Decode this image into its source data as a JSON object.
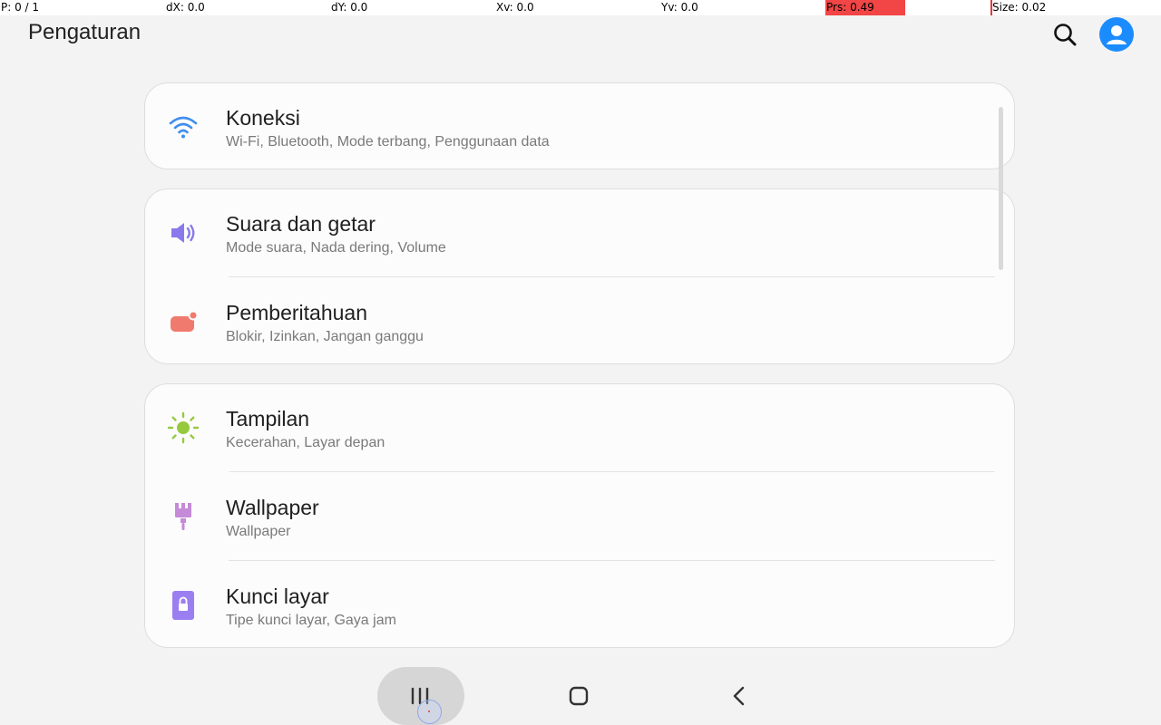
{
  "debug": {
    "pointer": "P: 0 / 1",
    "dx": "dX: 0.0",
    "dy": "dY: 0.0",
    "xv": "Xv: 0.0",
    "yv": "Yv: 0.0",
    "prs": "Prs: 0.49",
    "size": "Size: 0.02"
  },
  "header": {
    "title": "Pengaturan",
    "search_icon": "search-icon",
    "avatar_icon": "account-icon",
    "avatar_color": "#1a8cff"
  },
  "settings": {
    "connections": {
      "label": "Koneksi",
      "sub": "Wi-Fi, Bluetooth, Mode terbang, Penggunaan data",
      "icon": "wifi-icon",
      "color": "#3f8ef0"
    },
    "sound": {
      "label": "Suara dan getar",
      "sub": "Mode suara, Nada dering, Volume",
      "icon": "speaker-icon",
      "color": "#8a79ea"
    },
    "notifications": {
      "label": "Pemberitahuan",
      "sub": "Blokir, Izinkan, Jangan ganggu",
      "icon": "notification-badge-icon",
      "color": "#f07a6e"
    },
    "display": {
      "label": "Tampilan",
      "sub": "Kecerahan, Layar depan",
      "icon": "brightness-icon",
      "color": "#96c93d"
    },
    "wallpaper": {
      "label": "Wallpaper",
      "sub": "Wallpaper",
      "icon": "brush-icon",
      "color": "#c58ad8"
    },
    "lockscreen": {
      "label": "Kunci layar",
      "sub": "Tipe kunci layar, Gaya jam",
      "icon": "lock-icon",
      "color": "#9b7ff0"
    }
  },
  "navigation": {
    "recent_icon": "recent-apps-icon",
    "home_icon": "home-icon",
    "back_icon": "back-icon"
  }
}
